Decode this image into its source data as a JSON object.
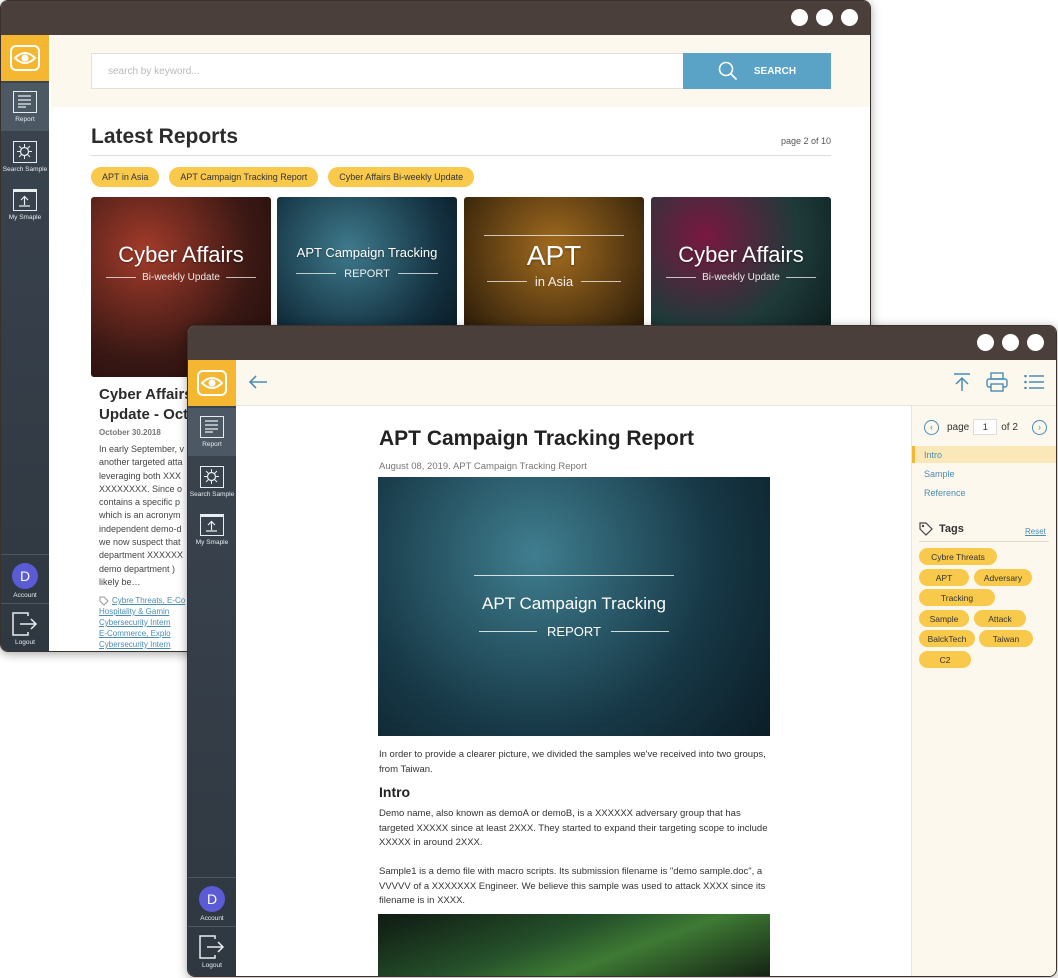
{
  "nav": {
    "report": "Report",
    "search_sample": "Search Sample",
    "my_sample": "My Smaple",
    "account": "Account",
    "account_initial": "D",
    "logout": "Logout"
  },
  "win1": {
    "search_placeholder": "search by keyword...",
    "search_button": "SEARCH",
    "heading": "Latest Reports",
    "page_info": "page 2 of 10",
    "chips": [
      "APT in Asia",
      "APT Campaign Tracking Report",
      "Cyber Affairs Bi-weekly Update"
    ],
    "cards": [
      {
        "big": "Cyber Affairs",
        "small": "Bi-weekly Update"
      },
      {
        "big": "APT Campaign Tracking",
        "small": "REPORT"
      },
      {
        "big": "APT",
        "small": "in Asia"
      },
      {
        "big": "Cyber Affairs",
        "small": "Bi-weekly Update"
      }
    ],
    "article": {
      "title_line1": "Cyber Affairs",
      "title_line2": "Update - Oct.",
      "date": "October 30.2018",
      "lines": [
        "In early September, v",
        "another targeted atta",
        "leveraging both XXX",
        "XXXXXXXX. Since o",
        "contains a specific p",
        "which is an acronym",
        "independent demo-d",
        "we now suspect that",
        "department XXXXXX",
        "demo department )",
        "likely be…"
      ],
      "tags": [
        "Cybre Threats, E-Co",
        "Hospitality & Gamin",
        "Cybersecurity Intern",
        "E-Commerce, Explo",
        "Cybersecurity Intern"
      ]
    }
  },
  "win2": {
    "title": "APT Campaign Tracking Report",
    "meta": "August 08, 2019. APT Campaign Tracking Report",
    "hero_big": "APT Campaign Tracking",
    "hero_small": "REPORT",
    "p1": "In order to provide a clearer picture, we divided the samples we've received into two groups, from Taiwan.",
    "h2": "Intro",
    "p2": "Demo name, also known as demoA or demoB, is a XXXXXX adversary group that has targeted XXXXX since at least 2XXX. They started to expand their targeting scope to include XXXXX in around 2XXX.",
    "p3": "Sample1 is a demo file with macro scripts. Its submission filename is \"demo sample.doc\", a VVVVV of a XXXXXXX Engineer. We believe this sample was used to attack XXXX since its filename is in XXXX.",
    "pager_label": "page",
    "page_current": "1",
    "page_total": "of 2",
    "toc": [
      "Intro",
      "Sample",
      "Reference"
    ],
    "tags_heading": "Tags",
    "reset": "Reset",
    "tags": [
      "Cybre Threats",
      "APT",
      "Adversary",
      "Tracking",
      "Sample",
      "Attack",
      "BalckTech",
      "Taiwan",
      "C2"
    ]
  },
  "colors": {
    "accent": "#f5b731",
    "chip": "#f8c94a",
    "search_button": "#5aa2c6",
    "sidebar": "#2f3740",
    "titlebar": "#4a3f3a"
  }
}
